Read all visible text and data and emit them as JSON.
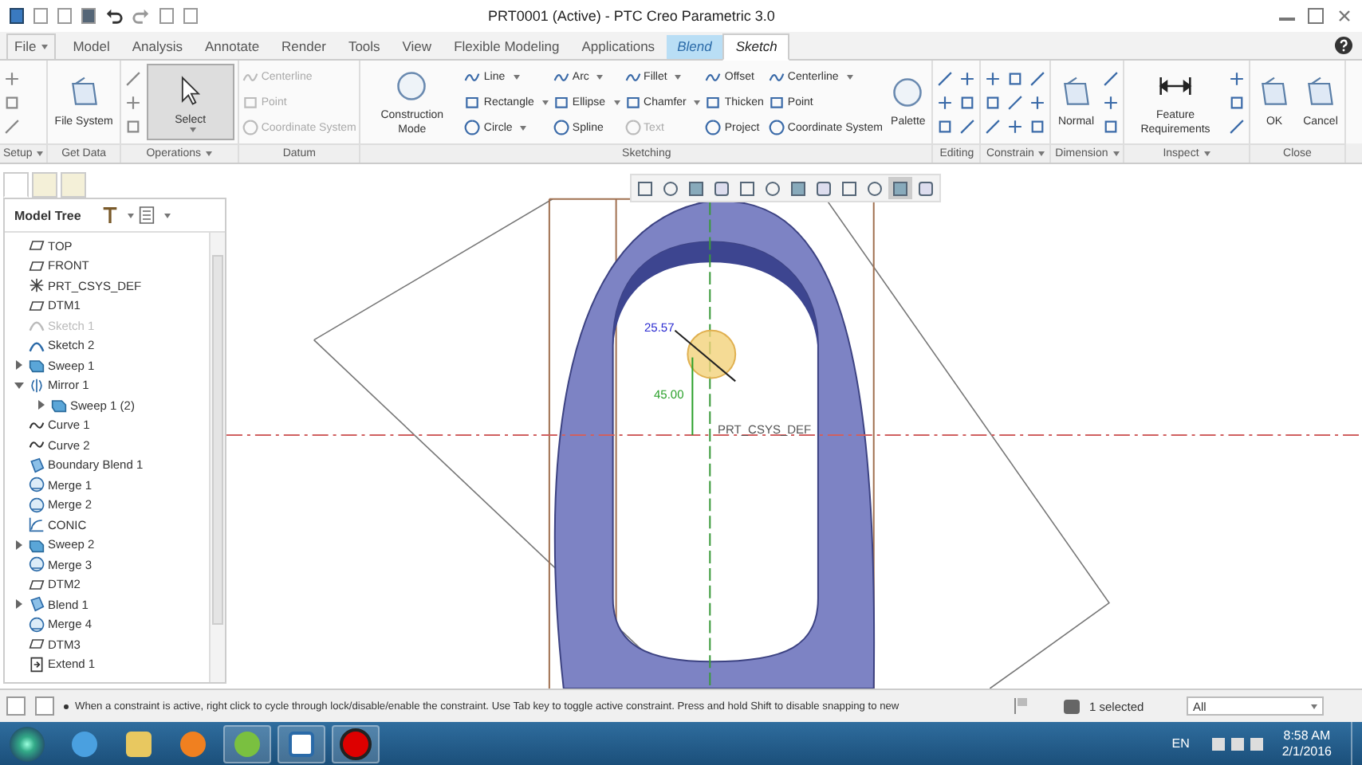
{
  "window": {
    "title": "PRT0001 (Active) - PTC Creo Parametric 3.0"
  },
  "tabs": [
    {
      "label": "File",
      "kind": "menu",
      "selected": false
    },
    {
      "label": "Model",
      "kind": "plain",
      "selected": false
    },
    {
      "label": "Analysis",
      "kind": "plain",
      "selected": false
    },
    {
      "label": "Annotate",
      "kind": "plain",
      "selected": false
    },
    {
      "label": "Render",
      "kind": "plain",
      "selected": false
    },
    {
      "label": "Tools",
      "kind": "plain",
      "selected": false
    },
    {
      "label": "View",
      "kind": "plain",
      "selected": false
    },
    {
      "label": "Flexible Modeling",
      "kind": "plain",
      "selected": false
    },
    {
      "label": "Applications",
      "kind": "plain",
      "selected": false
    },
    {
      "label": "Blend",
      "kind": "context",
      "selected": false
    },
    {
      "label": "Sketch",
      "kind": "plain",
      "selected": true
    }
  ],
  "groups": [
    {
      "label": "Setup",
      "menu": true,
      "columns": [
        {
          "kind": "icons"
        }
      ]
    },
    {
      "label": "Get Data",
      "menu": false,
      "columns": [
        {
          "kind": "big",
          "label": "File System",
          "menu": false,
          "selected": false
        }
      ]
    },
    {
      "label": "Operations",
      "menu": true,
      "columns": [
        {
          "kind": "icons"
        },
        {
          "kind": "big",
          "label": "Select",
          "menu": true,
          "selected": true
        }
      ]
    },
    {
      "label": "Datum",
      "menu": false,
      "columns": [
        {
          "kind": "rows",
          "items": [
            {
              "label": "Centerline",
              "menu": false,
              "disabled": true
            },
            {
              "label": "Point",
              "menu": false,
              "disabled": true
            },
            {
              "label": "Coordinate System",
              "menu": false,
              "disabled": true
            }
          ]
        }
      ]
    },
    {
      "label": "Sketching",
      "menu": false,
      "columns": [
        {
          "kind": "big",
          "label": "Construction Mode",
          "menu": false,
          "selected": false
        },
        {
          "kind": "rows",
          "items": [
            {
              "label": "Line",
              "menu": true,
              "disabled": false
            },
            {
              "label": "Rectangle",
              "menu": true,
              "disabled": false
            },
            {
              "label": "Circle",
              "menu": true,
              "disabled": false
            }
          ]
        },
        {
          "kind": "rows",
          "items": [
            {
              "label": "Arc",
              "menu": true,
              "disabled": false
            },
            {
              "label": "Ellipse",
              "menu": true,
              "disabled": false
            },
            {
              "label": "Spline",
              "menu": false,
              "disabled": false
            }
          ]
        },
        {
          "kind": "rows",
          "items": [
            {
              "label": "Fillet",
              "menu": true,
              "disabled": false
            },
            {
              "label": "Chamfer",
              "menu": true,
              "disabled": false
            },
            {
              "label": "Text",
              "menu": false,
              "disabled": true
            }
          ]
        },
        {
          "kind": "rows",
          "items": [
            {
              "label": "Offset",
              "menu": false,
              "disabled": false
            },
            {
              "label": "Thicken",
              "menu": false,
              "disabled": false
            },
            {
              "label": "Project",
              "menu": false,
              "disabled": false
            }
          ]
        },
        {
          "kind": "rows",
          "items": [
            {
              "label": "Centerline",
              "menu": true,
              "disabled": false
            },
            {
              "label": "Point",
              "menu": false,
              "disabled": false
            },
            {
              "label": "Coordinate System",
              "menu": false,
              "disabled": false
            }
          ]
        },
        {
          "kind": "big",
          "label": "Palette",
          "menu": false,
          "selected": false
        }
      ]
    },
    {
      "label": "Editing",
      "menu": false,
      "columns": [
        {
          "kind": "icons"
        },
        {
          "kind": "icons"
        }
      ]
    },
    {
      "label": "Constrain",
      "menu": true,
      "columns": [
        {
          "kind": "icons"
        },
        {
          "kind": "icons"
        },
        {
          "kind": "icons"
        }
      ]
    },
    {
      "label": "Dimension",
      "menu": true,
      "columns": [
        {
          "kind": "big",
          "label": "Normal",
          "menu": false,
          "selected": false
        },
        {
          "kind": "icons"
        }
      ]
    },
    {
      "label": "Inspect",
      "menu": true,
      "columns": [
        {
          "kind": "big",
          "label": "Feature Requirements",
          "menu": false,
          "selected": false
        },
        {
          "kind": "icons"
        }
      ]
    },
    {
      "label": "Close",
      "menu": false,
      "columns": [
        {
          "kind": "big",
          "label": "OK",
          "menu": false,
          "selected": false
        },
        {
          "kind": "big",
          "label": "Cancel",
          "menu": false,
          "selected": false
        }
      ]
    }
  ],
  "model_tree": {
    "title": "Model Tree",
    "items": [
      {
        "label": "TOP",
        "kind": "plane",
        "disabled": false
      },
      {
        "label": "FRONT",
        "kind": "plane",
        "disabled": false
      },
      {
        "label": "PRT_CSYS_DEF",
        "kind": "csys",
        "disabled": false
      },
      {
        "label": "DTM1",
        "kind": "plane",
        "disabled": false
      },
      {
        "label": "Sketch 1",
        "kind": "sketch",
        "disabled": true
      },
      {
        "label": "Sketch 2",
        "kind": "sketch",
        "disabled": false
      },
      {
        "label": "Sweep 1",
        "kind": "sweep",
        "disabled": false,
        "expanded": false
      },
      {
        "label": "Mirror 1",
        "kind": "mirror",
        "disabled": false,
        "expanded": true,
        "children": [
          {
            "label": "Sweep 1 (2)",
            "kind": "sweep",
            "disabled": false,
            "expanded": false
          }
        ]
      },
      {
        "label": "Curve 1",
        "kind": "curve",
        "disabled": false
      },
      {
        "label": "Curve 2",
        "kind": "curve",
        "disabled": false
      },
      {
        "label": "Boundary Blend 1",
        "kind": "boundary",
        "disabled": false
      },
      {
        "label": "Merge 1",
        "kind": "merge",
        "disabled": false
      },
      {
        "label": "Merge 2",
        "kind": "merge",
        "disabled": false
      },
      {
        "label": "CONIC",
        "kind": "conic",
        "disabled": false
      },
      {
        "label": "Sweep 2",
        "kind": "sweep",
        "disabled": false,
        "expanded": false
      },
      {
        "label": "Merge 3",
        "kind": "merge",
        "disabled": false
      },
      {
        "label": "DTM2",
        "kind": "plane",
        "disabled": false
      },
      {
        "label": "Blend 1",
        "kind": "blend",
        "disabled": false,
        "expanded": false
      },
      {
        "label": "Merge 4",
        "kind": "merge",
        "disabled": false
      },
      {
        "label": "DTM3",
        "kind": "plane",
        "disabled": false
      },
      {
        "label": "Extend 1",
        "kind": "extend",
        "disabled": false
      }
    ]
  },
  "canvas": {
    "diameter_dimension": "25.57",
    "height_dimension": "45.00",
    "csys_label": "PRT_CSYS_DEF"
  },
  "status_bar": {
    "message": "When a constraint is active, right click to cycle through lock/disable/enable the constraint. Use Tab key to toggle active constraint. Press and hold Shift to disable snapping to new",
    "selection": "1 selected",
    "filter": "All"
  },
  "taskbar": {
    "language": "EN",
    "time": "8:58 AM",
    "date": "2/1/2016"
  }
}
